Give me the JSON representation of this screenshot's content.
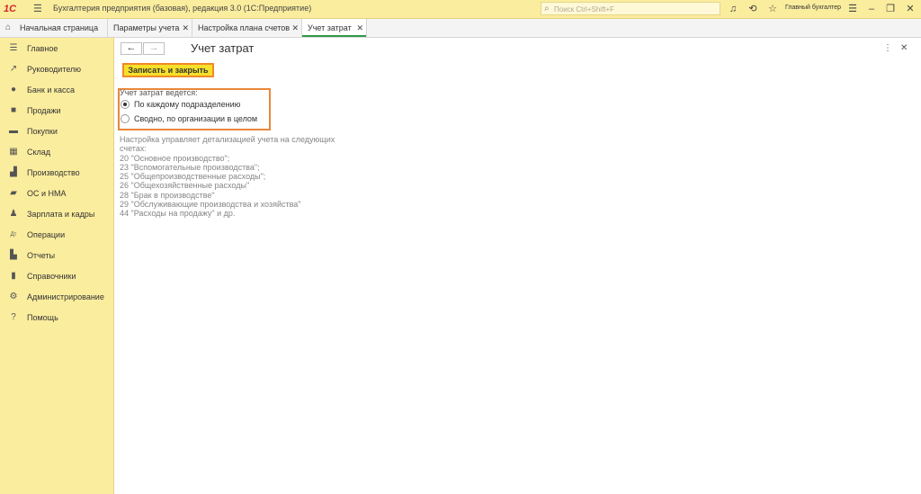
{
  "app": {
    "logo": "1С",
    "title": "Бухгалтерия предприятия (базовая), редакция 3.0  (1С:Предприятие)",
    "search_placeholder": "Поиск Ctrl+Shift+F",
    "user": "Главный бухгалтер"
  },
  "tabs": [
    {
      "label": "Начальная страница"
    },
    {
      "label": "Параметры учета"
    },
    {
      "label": "Настройка плана счетов"
    },
    {
      "label": "Учет затрат"
    }
  ],
  "sidebar": {
    "items": [
      {
        "label": "Главное",
        "icon": "menu-icon"
      },
      {
        "label": "Руководителю",
        "icon": "trend-icon"
      },
      {
        "label": "Банк и касса",
        "icon": "coins-icon"
      },
      {
        "label": "Продажи",
        "icon": "bag-icon"
      },
      {
        "label": "Покупки",
        "icon": "cart-icon"
      },
      {
        "label": "Склад",
        "icon": "warehouse-icon"
      },
      {
        "label": "Производство",
        "icon": "factory-icon"
      },
      {
        "label": "ОС и НМА",
        "icon": "truck-icon"
      },
      {
        "label": "Зарплата и кадры",
        "icon": "person-icon"
      },
      {
        "label": "Операции",
        "icon": "dt-kt-icon"
      },
      {
        "label": "Отчеты",
        "icon": "bar-chart-icon"
      },
      {
        "label": "Справочники",
        "icon": "book-icon"
      },
      {
        "label": "Администрирование",
        "icon": "gear-icon"
      },
      {
        "label": "Помощь",
        "icon": "question-icon"
      }
    ]
  },
  "form": {
    "title": "Учет затрат",
    "save_close_label": "Записать и закрыть",
    "group_label": "Учет затрат ведется:",
    "options": [
      {
        "label": "По каждому подразделению",
        "selected": true
      },
      {
        "label": "Сводно, по организации в целом",
        "selected": false
      }
    ],
    "description": [
      "Настройка управляет детализацией учета на следующих",
      "счетах:",
      "20 \"Основное производство\";",
      "23 \"Вспомогательные производства\";",
      "25 \"Общепроизводственные расходы\";",
      "26 \"Общехозяйственные расходы\"",
      "28 \"Брак в производстве\"",
      "29 \"Обслуживающие производства и хозяйства\"",
      "44 \"Расходы на продажу\" и др."
    ]
  },
  "colors": {
    "titlebar_bg": "#fbed9e",
    "sidebar_bg": "#fbed9e",
    "primary_button": "#f6e029",
    "highlight_frame": "#f08a2a",
    "active_tab_underline": "#2e9b4a"
  }
}
